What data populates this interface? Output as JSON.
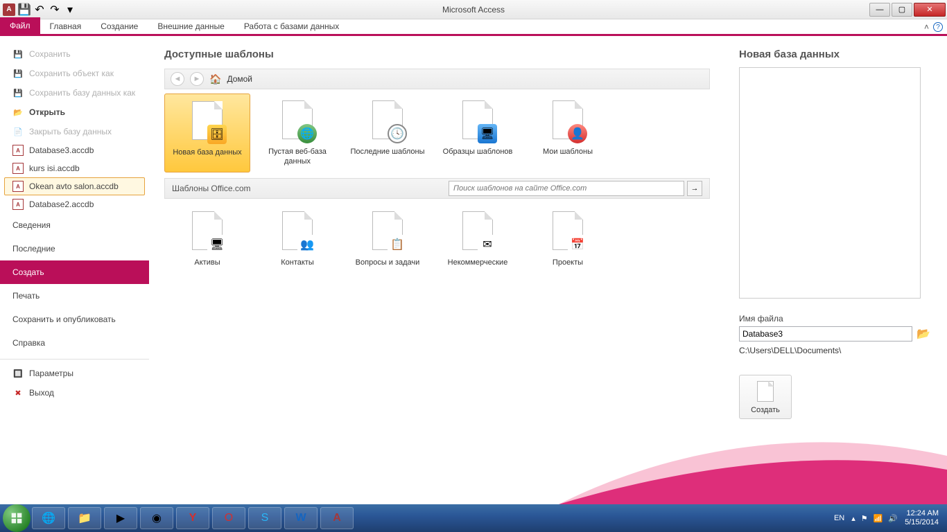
{
  "titlebar": {
    "app_title": "Microsoft Access"
  },
  "window_controls": {
    "min": "—",
    "max": "▢",
    "close": "✕"
  },
  "ribbon": {
    "file": "Файл",
    "tabs": [
      "Главная",
      "Создание",
      "Внешние данные",
      "Работа с базами данных"
    ],
    "help_glyph": "?",
    "min_glyph": "˄"
  },
  "sidebar": {
    "save": "Сохранить",
    "save_object_as": "Сохранить объект как",
    "save_db_as": "Сохранить базу данных как",
    "open": "Открыть",
    "close_db": "Закрыть базу данных",
    "recent_files": [
      "Database3.accdb",
      "kurs isi.accdb",
      "Okean avto salon.accdb",
      "Database2.accdb"
    ],
    "info": "Сведения",
    "recent": "Последние",
    "create": "Создать",
    "print": "Печать",
    "save_publish": "Сохранить и опубликовать",
    "help": "Справка",
    "options": "Параметры",
    "exit": "Выход"
  },
  "content": {
    "heading": "Доступные шаблоны",
    "breadcrumb_home": "Домой",
    "templates_row1": [
      {
        "label": "Новая база данных",
        "selected": true,
        "badge": "db"
      },
      {
        "label": "Пустая веб-база данных",
        "selected": false,
        "badge": "globe"
      },
      {
        "label": "Последние шаблоны",
        "selected": false,
        "badge": "clock"
      },
      {
        "label": "Образцы шаблонов",
        "selected": false,
        "badge": "sample"
      },
      {
        "label": "Мои шаблоны",
        "selected": false,
        "badge": "user"
      }
    ],
    "office_section_label": "Шаблоны Office.com",
    "search_placeholder": "Поиск шаблонов на сайте Office.com",
    "search_go": "→",
    "templates_row2": [
      {
        "label": "Активы"
      },
      {
        "label": "Контакты"
      },
      {
        "label": "Вопросы и задачи"
      },
      {
        "label": "Некоммерческие"
      },
      {
        "label": "Проекты"
      }
    ]
  },
  "right": {
    "heading": "Новая база данных",
    "filename_label": "Имя файла",
    "filename_value": "Database3",
    "path": "C:\\Users\\DELL\\Documents\\",
    "create_label": "Создать"
  },
  "taskbar": {
    "lang": "EN",
    "time": "12:24 AM",
    "date": "5/15/2014"
  }
}
